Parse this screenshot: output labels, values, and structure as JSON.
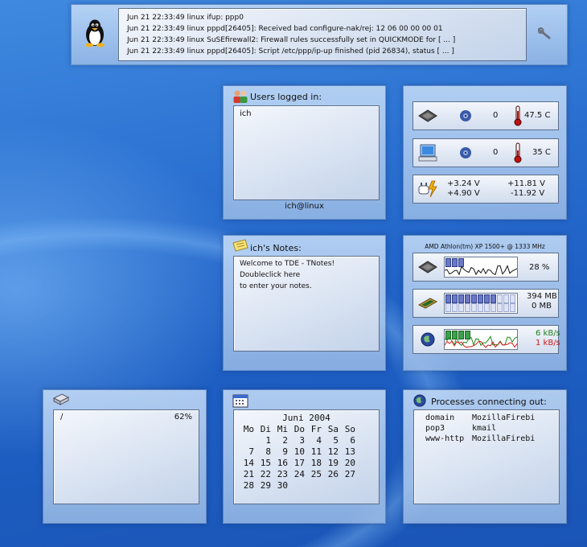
{
  "log": {
    "lines": [
      "Jun 21 22:33:49 linux ifup:     ppp0",
      "Jun 21 22:33:49 linux pppd[26405]: Received bad configure-nak/rej:  12 06 00 00 00 01",
      "Jun 21 22:33:49 linux SuSEfirewall2: Firewall rules successfully set in QUICKMODE for   [ ... ]",
      "Jun 21 22:33:49 linux pppd[26405]: Script /etc/ppp/ip-up finished (pid 26834), status   [ ... ]"
    ]
  },
  "users": {
    "title": "Users logged in:",
    "list": [
      "ich"
    ],
    "footer": "ich@linux"
  },
  "sensors": {
    "cpu": {
      "fan": "0",
      "temp": "47.5 C"
    },
    "mb": {
      "fan": "0",
      "temp": "35 C"
    },
    "volt": {
      "v1": "+3.24 V",
      "v2": "+4.90 V",
      "v3": "+11.81 V",
      "v4": "-11.92 V"
    }
  },
  "notes": {
    "title": "ich's Notes:",
    "lines": [
      "Welcome to TDE - TNotes!",
      "Doubleclick here",
      "to enter your notes."
    ]
  },
  "sysmon": {
    "cpu_name": "AMD Athlon(tm) XP 1500+ @ 1333 MHz",
    "cpu_load": "28 %",
    "mem_used": "394 MB",
    "swap_used": "0 MB",
    "net_in": "6 kB/s",
    "net_out": "1 kB/s",
    "net_in_color": "#1d7f1d",
    "net_out_color": "#d01818"
  },
  "disk": {
    "mount": "/",
    "usage": "62%"
  },
  "calendar": {
    "header": "Juni 2004",
    "days": [
      "Mo",
      "Di",
      "Mi",
      "Do",
      "Fr",
      "Sa",
      "So"
    ],
    "cells": [
      "",
      "1",
      "2",
      "3",
      "4",
      "5",
      "6",
      "7",
      "8",
      "9",
      "10",
      "11",
      "12",
      "13",
      "14",
      "15",
      "16",
      "17",
      "18",
      "19",
      "20",
      "21",
      "22",
      "23",
      "24",
      "25",
      "26",
      "27",
      "28",
      "29",
      "30",
      "",
      "",
      "",
      ""
    ]
  },
  "processes": {
    "title": "Processes connecting out:",
    "rows": [
      {
        "service": "domain",
        "app": "MozillaFirebi"
      },
      {
        "service": "pop3",
        "app": "kmail"
      },
      {
        "service": "www-http",
        "app": "MozillaFirebi"
      }
    ]
  }
}
